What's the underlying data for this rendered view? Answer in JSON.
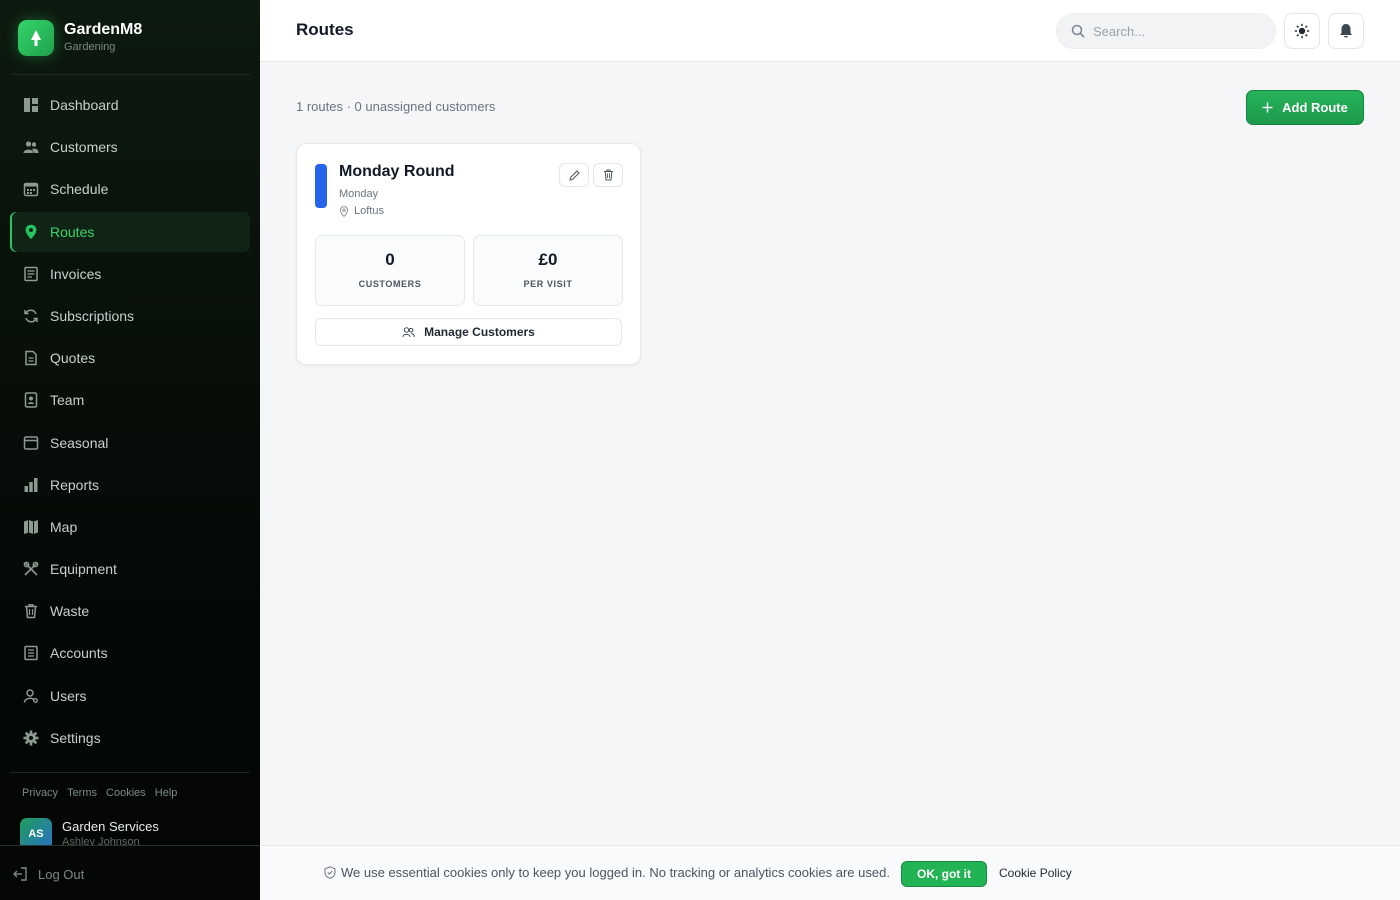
{
  "brand": {
    "name": "GardenM8",
    "subtitle": "Gardening",
    "icon": "tree-icon",
    "accent": "#22c55e"
  },
  "sidebar": {
    "items": [
      {
        "label": "Dashboard",
        "icon": "dashboard-icon",
        "active": false
      },
      {
        "label": "Customers",
        "icon": "users-icon",
        "active": false
      },
      {
        "label": "Schedule",
        "icon": "calendar-icon",
        "active": false
      },
      {
        "label": "Routes",
        "icon": "map-pin-icon",
        "active": true
      },
      {
        "label": "Invoices",
        "icon": "invoice-icon",
        "active": false
      },
      {
        "label": "Subscriptions",
        "icon": "refresh-icon",
        "active": false
      },
      {
        "label": "Quotes",
        "icon": "document-icon",
        "active": false
      },
      {
        "label": "Team",
        "icon": "id-badge-icon",
        "active": false
      },
      {
        "label": "Seasonal",
        "icon": "calendar-card-icon",
        "active": false
      },
      {
        "label": "Reports",
        "icon": "bar-chart-icon",
        "active": false
      },
      {
        "label": "Map",
        "icon": "map-icon",
        "active": false
      },
      {
        "label": "Equipment",
        "icon": "tools-icon",
        "active": false
      },
      {
        "label": "Waste",
        "icon": "trash-icon",
        "active": false
      },
      {
        "label": "Accounts",
        "icon": "ledger-icon",
        "active": false
      },
      {
        "label": "Users",
        "icon": "user-key-icon",
        "active": false
      },
      {
        "label": "Settings",
        "icon": "gear-icon",
        "active": false
      }
    ],
    "footer_links": [
      "Privacy",
      "Terms",
      "Cookies",
      "Help"
    ],
    "user": {
      "initials": "AS",
      "org": "Garden Services",
      "name": "Ashley Johnson"
    },
    "logout_label": "Log Out"
  },
  "header": {
    "title": "Routes",
    "search_placeholder": "Search...",
    "theme_icon": "sun-icon",
    "notification_icon": "bell-icon"
  },
  "main": {
    "summary": "1 routes · 0 unassigned customers",
    "add_button_label": "Add Route",
    "routes": [
      {
        "name": "Monday Round",
        "day": "Monday",
        "location": "Loftus",
        "color": "#2563eb",
        "customers_value": "0",
        "customers_label": "CUSTOMERS",
        "per_visit_value": "£0",
        "per_visit_label": "PER VISIT",
        "manage_label": "Manage Customers"
      }
    ]
  },
  "cookie_bar": {
    "text": "We use essential cookies only to keep you logged in. No tracking or analytics cookies are used.",
    "ok_label": "OK, got it",
    "policy_label": "Cookie Policy"
  }
}
